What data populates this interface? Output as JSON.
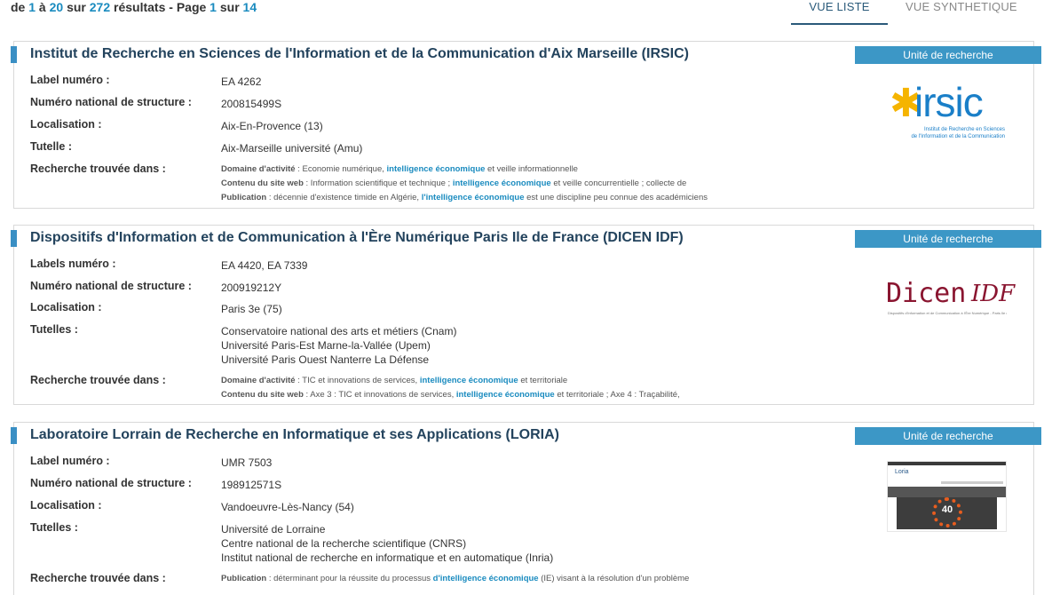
{
  "results": {
    "prefix": "de",
    "from": "1",
    "to_word": "à",
    "to": "20",
    "on_word": "sur",
    "total": "272",
    "results_word": "résultats",
    "page_word": "- Page",
    "page": "1",
    "of_word": "sur",
    "pages": "14"
  },
  "view_tabs": {
    "list": "VUE LISTE",
    "synthetic": "VUE SYNTHETIQUE"
  },
  "cards": [
    {
      "title": "Institut de Recherche en Sciences de l'Information et de la Communication d'Aix Marseille (IRSIC)",
      "badge": "Unité de recherche",
      "label_key": "Label numéro :",
      "label_value": "EA 4262",
      "national_key": "Numéro national de structure :",
      "national_value": "200815499S",
      "location_key": "Localisation :",
      "location_value": "Aix-En-Provence (13)",
      "tutelle_key": "Tutelle :",
      "tutelles": [
        "Aix-Marseille université (Amu)"
      ],
      "found_key": "Recherche trouvée dans :",
      "found": [
        {
          "k": "Domaine d'activité",
          "pre": " : Economie numérique, ",
          "hl": "intelligence économique",
          "post": " et veille informationnelle"
        },
        {
          "k": "Contenu du site web",
          "pre": " : Information scientifique et technique ; ",
          "hl": "intelligence économique",
          "post": " et veille concurrentielle ; collecte de"
        },
        {
          "k": "Publication",
          "pre": " : décennie d'existence timide en Algérie, ",
          "hl": "l'intelligence économique",
          "post": " est une discipline peu connue des académiciens"
        }
      ],
      "logo": {
        "text": "irsic",
        "star": "✱",
        "subtitle_1": "Institut de Recherche en Sciences",
        "subtitle_2": "de l'Information et de la Communication"
      }
    },
    {
      "title": "Dispositifs d'Information et de Communication à l'Ère Numérique Paris Ile de France (DICEN IDF)",
      "badge": "Unité de recherche",
      "label_key": "Labels numéro :",
      "label_value": "EA 4420, EA 7339",
      "national_key": "Numéro national de structure :",
      "national_value": "200919212Y",
      "location_key": "Localisation :",
      "location_value": "Paris 3e (75)",
      "tutelle_key": "Tutelles :",
      "tutelles": [
        "Conservatoire national des arts et métiers (Cnam)",
        "Université Paris-Est Marne-la-Vallée (Upem)",
        "Université Paris Ouest Nanterre La Défense"
      ],
      "found_key": "Recherche trouvée dans :",
      "found": [
        {
          "k": "Domaine d'activité",
          "pre": " : TIC et innovations de services, ",
          "hl": "intelligence économique",
          "post": " et territoriale"
        },
        {
          "k": "Contenu du site web",
          "pre": " : Axe 3 : TIC et innovations de services, ",
          "hl": "intelligence économique",
          "post": " et territoriale ; Axe 4 : Traçabilité,"
        }
      ],
      "logo": {
        "text_a": "Dicen",
        "text_b": "IDF",
        "subtitle": "Dispositifs d'Information et de Communication à l'Ère Numérique - Paris Ile de France"
      }
    },
    {
      "title": "Laboratoire Lorrain de Recherche en Informatique et ses Applications (LORIA)",
      "badge": "Unité de recherche",
      "label_key": "Label numéro :",
      "label_value": "UMR 7503",
      "national_key": "Numéro national de structure :",
      "national_value": "198912571S",
      "location_key": "Localisation :",
      "location_value": "Vandoeuvre-Lès-Nancy (54)",
      "tutelle_key": "Tutelles :",
      "tutelles": [
        "Université de Lorraine",
        "Centre national de la recherche scientifique (CNRS)",
        "Institut national de recherche en informatique et en automatique (Inria)"
      ],
      "found_key": "Recherche trouvée dans :",
      "found": [
        {
          "k": "Publication",
          "pre": " : déterminant pour la réussite du processus ",
          "hl": "d'intelligence économique",
          "post": " (IE) visant à la résolution d'un problème"
        }
      ],
      "logo": {
        "text": "Loria",
        "anniv": "40"
      }
    }
  ],
  "colors": {
    "accent": "#3c97c6",
    "title": "#23435d",
    "link": "#1a8bbf"
  }
}
